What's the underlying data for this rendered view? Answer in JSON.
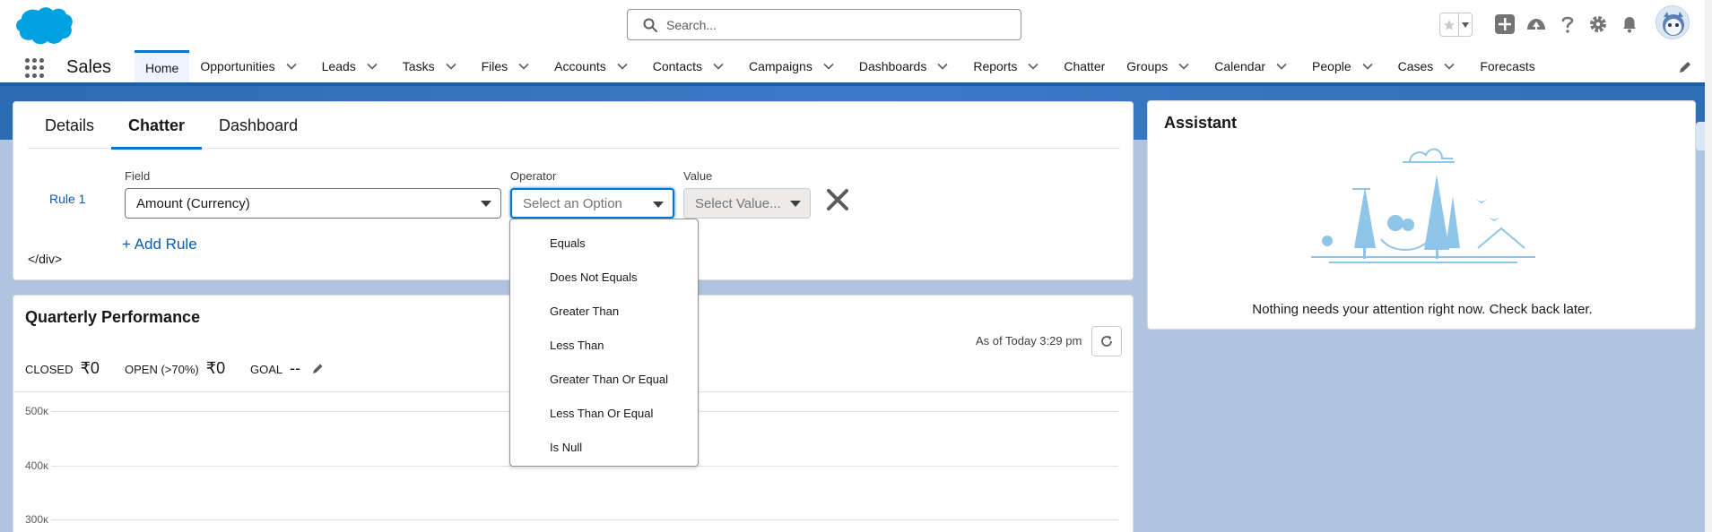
{
  "header": {
    "search_placeholder": "Search...",
    "icons": [
      "favorites-star-icon",
      "favorites-caret-icon",
      "global-add-icon",
      "trailhead-icon",
      "help-icon",
      "setup-gear-icon",
      "notifications-bell-icon"
    ]
  },
  "nav": {
    "app_name": "Sales",
    "items": [
      {
        "label": "Home",
        "active": true,
        "menu": false
      },
      {
        "label": "Opportunities",
        "menu": true
      },
      {
        "label": "Leads",
        "menu": true
      },
      {
        "label": "Tasks",
        "menu": true
      },
      {
        "label": "Files",
        "menu": true
      },
      {
        "label": "Accounts",
        "menu": true
      },
      {
        "label": "Contacts",
        "menu": true
      },
      {
        "label": "Campaigns",
        "menu": true
      },
      {
        "label": "Dashboards",
        "menu": true
      },
      {
        "label": "Reports",
        "menu": true
      },
      {
        "label": "Chatter",
        "menu": false
      },
      {
        "label": "Groups",
        "menu": true
      },
      {
        "label": "Calendar",
        "menu": true
      },
      {
        "label": "People",
        "menu": true
      },
      {
        "label": "Cases",
        "menu": true
      },
      {
        "label": "Forecasts",
        "menu": false
      }
    ]
  },
  "main": {
    "tabs": [
      "Details",
      "Chatter",
      "Dashboard"
    ],
    "active_tab": "Chatter",
    "rule": {
      "label": "Rule 1",
      "field_label": "Field",
      "field_value": "Amount (Currency)",
      "operator_label": "Operator",
      "operator_placeholder": "Select an Option",
      "value_label": "Value",
      "value_placeholder": "Select Value..."
    },
    "add_rule": "+ Add Rule",
    "stray_text": "</div>"
  },
  "operator_options": [
    "Equals",
    "Does Not Equals",
    "Greater Than",
    "Less Than",
    "Greater Than Or Equal",
    "Less Than Or Equal",
    "Is Null"
  ],
  "performance": {
    "title": "Quarterly Performance",
    "as_of": "As of Today 3:29 pm",
    "closed_label": "CLOSED",
    "closed_value": "₹0",
    "open_label": "OPEN (>70%)",
    "open_value": "₹0",
    "goal_label": "GOAL",
    "goal_value": "--",
    "y_ticks": [
      "500ĸ",
      "400ĸ",
      "300ĸ"
    ]
  },
  "assistant": {
    "title": "Assistant",
    "message": "Nothing needs your attention right now. Check back later."
  },
  "colors": {
    "brand_blue": "#0176d3",
    "link_blue": "#0b5cab",
    "nav_border": "#1b5fa6",
    "page_bg": "#b0c4df"
  }
}
